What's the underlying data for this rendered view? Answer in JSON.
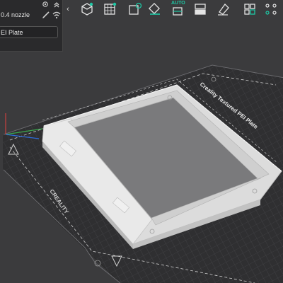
{
  "printer_panel": {
    "nozzle_label": "0.4 nozzle",
    "plate_value": "EI Plate",
    "collapse_glyph": "‹"
  },
  "toolbar": {
    "accent_color": "#1ec8a5",
    "buttons": [
      {
        "icon": "add-cube-icon"
      },
      {
        "icon": "grid-plate-icon"
      },
      {
        "icon": "settings-cog-icon"
      },
      {
        "icon": "orient-icon"
      },
      {
        "icon": "auto-arrange-icon",
        "label": "AUTO"
      },
      {
        "icon": "split-icon"
      },
      {
        "icon": "erase-icon"
      },
      {
        "icon": "layout-grid-icon"
      },
      {
        "icon": "dots-grid-icon"
      }
    ]
  },
  "build_plate": {
    "plate_text": "Creality Textured PEI Plate",
    "brand_text": "CREALITY"
  }
}
